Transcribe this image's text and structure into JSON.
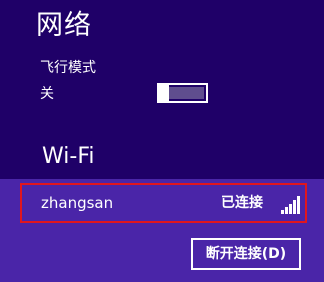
{
  "panel": {
    "title": "网络"
  },
  "airplane_mode": {
    "label": "飞行模式",
    "state_label": "关",
    "enabled": false
  },
  "wifi": {
    "header": "Wi-Fi",
    "networks": [
      {
        "name": "zhangsan",
        "status": "已连接",
        "signal_icon": "signal-bars-icon",
        "signal_bars": 5,
        "highlighted": true
      }
    ],
    "disconnect_label": "断开连接(D)"
  },
  "colors": {
    "background": "#1f0068",
    "selected_background": "#4a25a8",
    "highlight_border": "#e0161e",
    "toggle_off_track": "#5f4d8e",
    "foreground": "#ffffff"
  }
}
